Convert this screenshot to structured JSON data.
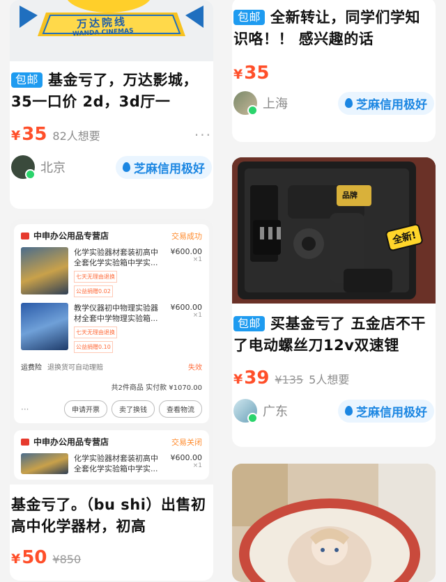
{
  "left": {
    "card1": {
      "banner_cn": "万达院线",
      "banner_en": "WANDA CINEMAS",
      "badge": "包邮",
      "title": "基金亏了，万达影城，35一口价 2d，3d厅一",
      "price": "35",
      "want": "82人想要",
      "more": "···",
      "location": "北京",
      "credit": "芝麻信用极好"
    },
    "card2": {
      "shop_name": "中申办公用品专营店",
      "status1": "交易成功",
      "items": [
        {
          "desc": "化学实验器材套装初高中全套化学实验箱中学实...",
          "price": "¥600.00",
          "qty": "×1",
          "tag1": "七天无理由退换",
          "tag2": "公益捐赠0.02"
        },
        {
          "desc": "教学仪器初中物理实验器材全套中学物理实验箱...",
          "price": "¥600.00",
          "qty": "×1",
          "tag1": "七天无理由退换",
          "tag2": "公益捐赠0.10"
        }
      ],
      "insurance_label": "运费险",
      "insurance_text": "退换货可自动理赔",
      "insurance_status": "失效",
      "total": "共2件商品 实付款 ¥1070.00",
      "btn_more": "···",
      "btn1": "申请开票",
      "btn2": "卖了换钱",
      "btn3": "查看物流",
      "status2": "交易关闭",
      "item3_desc": "化学实验器材套装初高中全套化学实验箱中学实...",
      "item3_price": "¥600.00",
      "item3_qty": "×1",
      "title": "基金亏了。（bu shi）出售初高中化学器材，初高",
      "price": "50",
      "orig": "¥850"
    }
  },
  "right": {
    "card1": {
      "badge": "包邮",
      "title": "全新转让，同学们学知识咯！！ 感兴趣的话",
      "price": "35",
      "location": "上海",
      "credit": "芝麻信用极好"
    },
    "card2": {
      "sticker": "全新!",
      "brand": "品牌",
      "badge": "包邮",
      "title": "买基金亏了 五金店不干了电动螺丝刀12v双速锂",
      "price": "39",
      "orig": "¥135",
      "want": "5人想要",
      "location": "广东",
      "credit": "芝麻信用极好"
    }
  },
  "yen": "¥",
  "colors": {
    "price": "#ff4f2a",
    "badge": "#1e9bf0",
    "credit": "#1b86e2",
    "status": "#ff8a2b"
  }
}
